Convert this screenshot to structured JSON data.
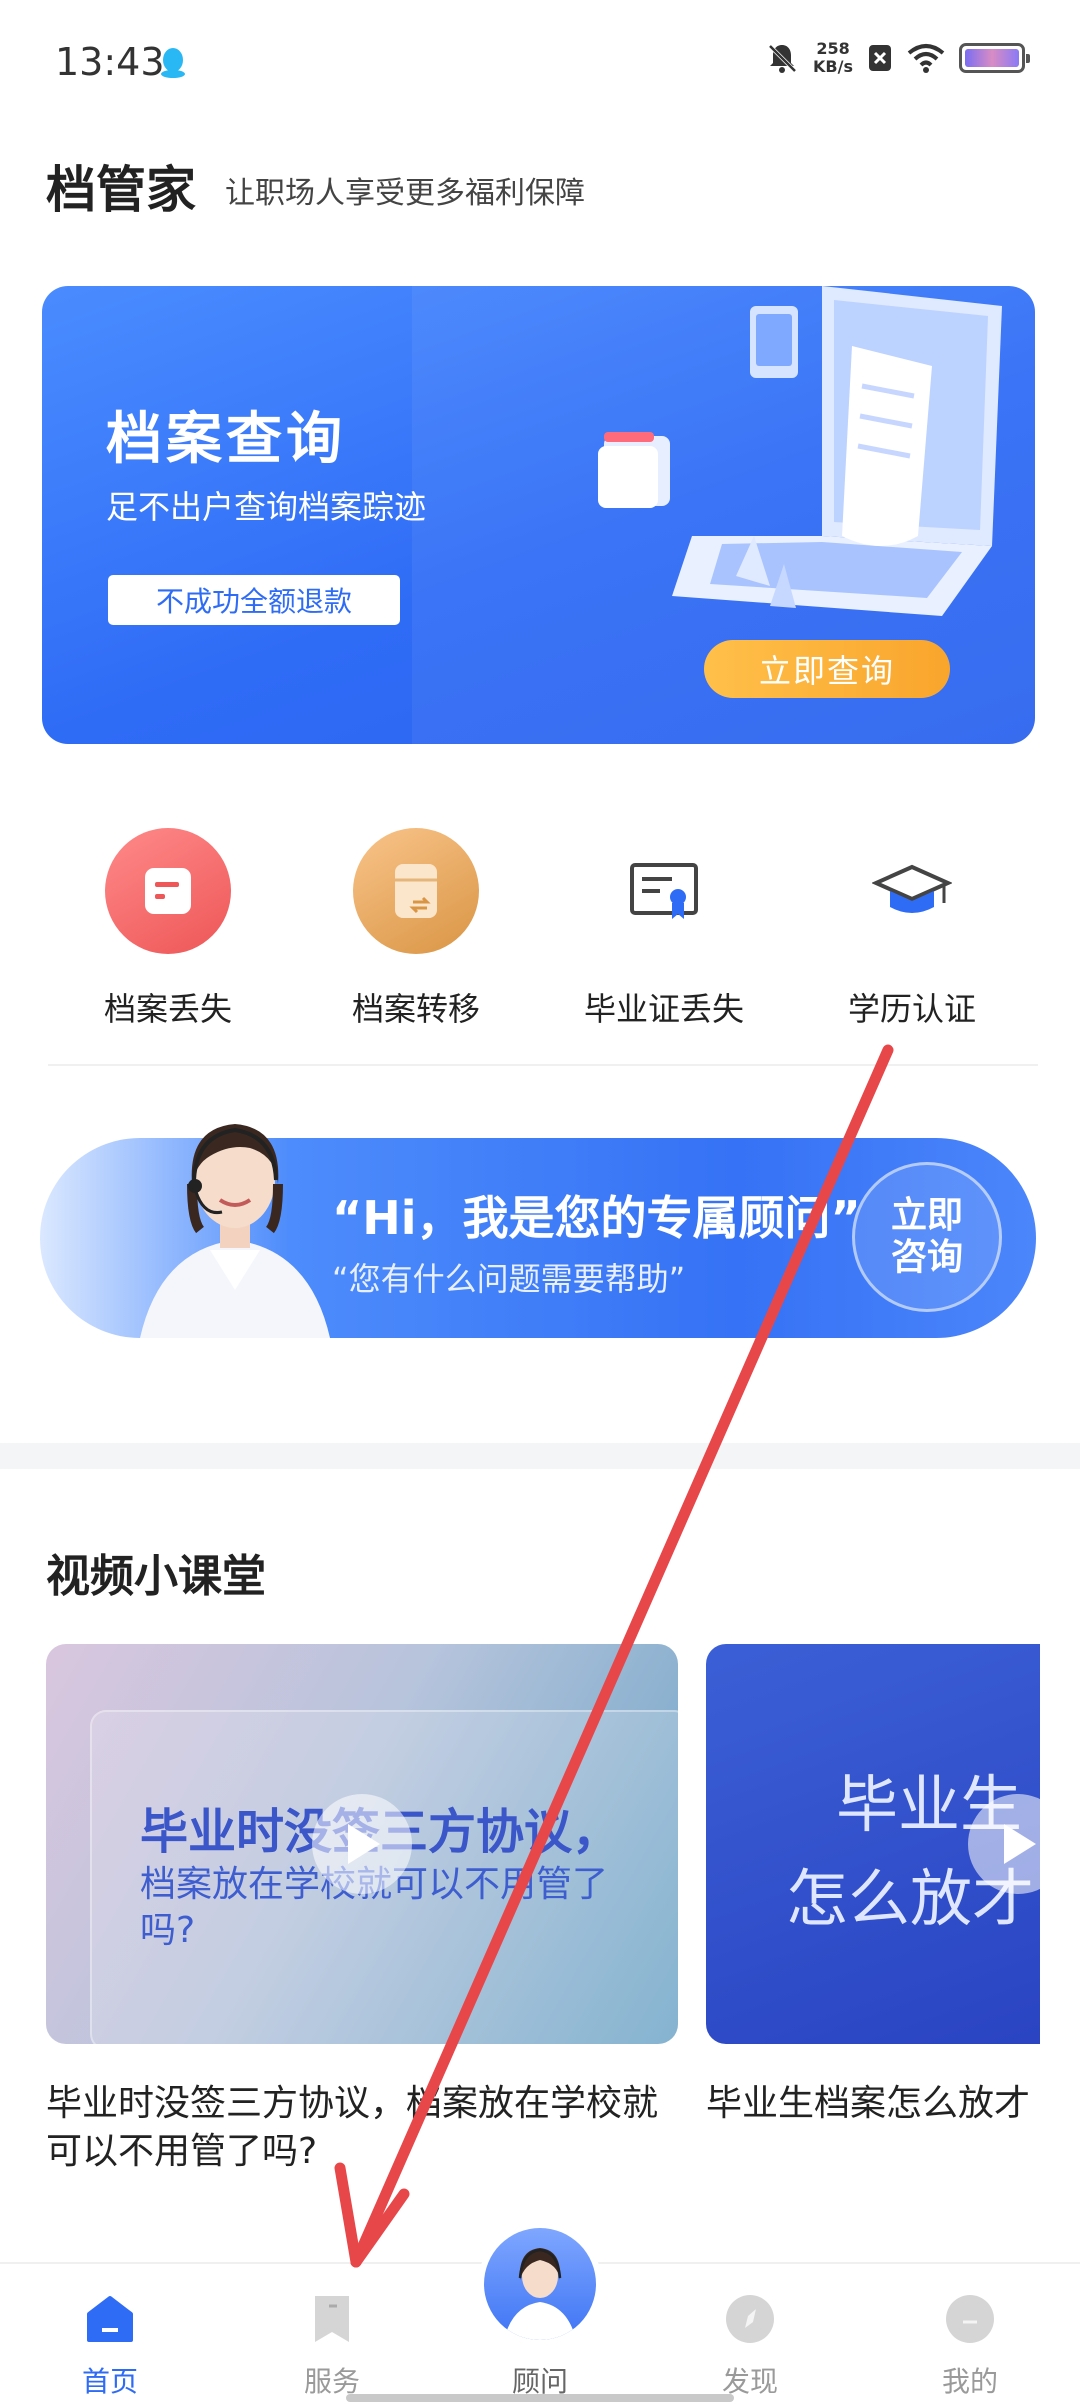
{
  "status_bar": {
    "time": "13:43",
    "speed_value": "258",
    "speed_unit": "KB/s"
  },
  "header": {
    "title": "档管家",
    "slogan": "让职场人享受更多福利保障"
  },
  "banner": {
    "title": "档案查询",
    "subtitle": "足不出户查询档案踪迹",
    "badge": "不成功全额退款",
    "cta": "立即查询"
  },
  "quick_services": [
    {
      "label": "档案丢失",
      "icon": "file-lost-icon"
    },
    {
      "label": "档案转移",
      "icon": "file-transfer-icon"
    },
    {
      "label": "毕业证丢失",
      "icon": "certificate-icon"
    },
    {
      "label": "学历认证",
      "icon": "graduation-cap-icon"
    }
  ],
  "consultant": {
    "title": "“Hi，我是您的专属顾问”",
    "subtitle": "“您有什么问题需要帮助”",
    "button": "立即咨询"
  },
  "video_section": {
    "title": "视频小课堂",
    "videos": [
      {
        "thumb_title": "毕业时没签三方协议，",
        "thumb_sub": "档案放在学校就可以不用管了吗?",
        "caption": "毕业时没签三方协议，档案放在学校就可以不用管了吗?"
      },
      {
        "thumb_title": "毕业生",
        "thumb_sub": "怎么放才",
        "caption": "毕业生档案怎么放才"
      }
    ]
  },
  "bottom_nav": {
    "items": [
      {
        "label": "首页",
        "icon": "home-icon",
        "active": true
      },
      {
        "label": "服务",
        "icon": "bookmark-icon",
        "active": false
      },
      {
        "label": "顾问",
        "icon": "advisor-avatar-icon",
        "active": false
      },
      {
        "label": "发现",
        "icon": "compass-icon",
        "active": false
      },
      {
        "label": "我的",
        "icon": "profile-icon",
        "active": false
      }
    ]
  },
  "colors": {
    "primary": "#2f6cf6",
    "cta_orange": "#f9a52c",
    "annotation_red": "#e8474a"
  }
}
